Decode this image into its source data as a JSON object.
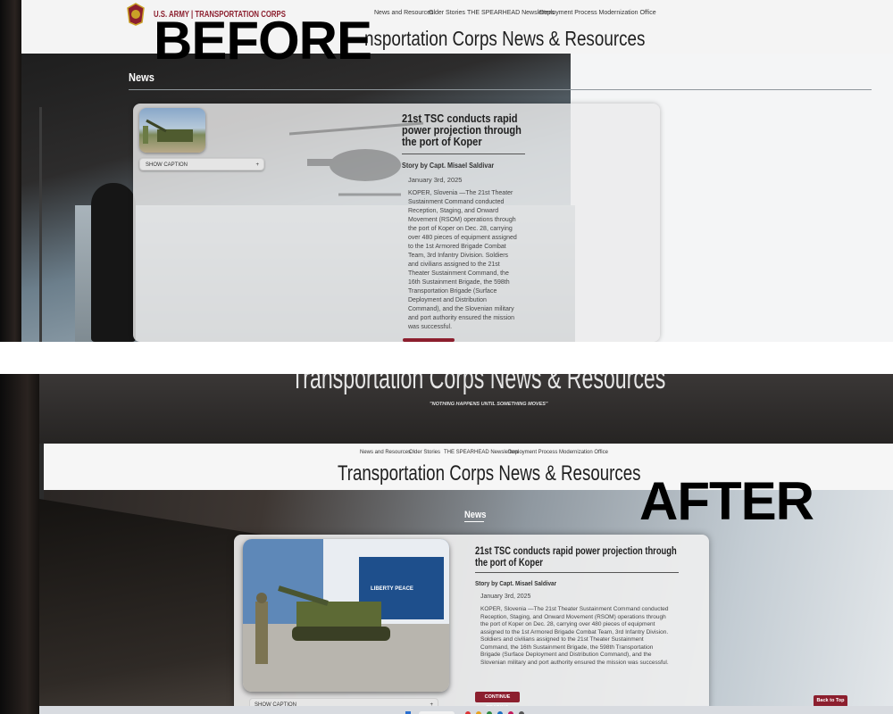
{
  "labels": {
    "before": "BEFORE",
    "after": "AFTER"
  },
  "site": {
    "brand": "U.S. ARMY | TRANSPORTATION CORPS",
    "nav": [
      "News and Resources",
      "Older Stories",
      "THE SPEARHEAD Newsletters",
      "Deployment Process Modernization Office"
    ],
    "page_title": "Transportation Corps News & Resources",
    "page_title_partial": "nsportation Corps News & Resources",
    "motto": "\"NOTHING HAPPENS UNTIL SOMETHING MOVES\"",
    "section": "News"
  },
  "article": {
    "title": "21st TSC conducts rapid power projection through the port of Koper",
    "byline": "Story by Capt. Misael Saldivar",
    "date": "January 3rd, 2025",
    "body": "KOPER, Slovenia —The 21st Theater Sustainment Command conducted Reception, Staging, and Onward Movement (RSOM) operations through the port of Koper on Dec. 28, carrying over 480 pieces of equipment assigned to the 1st Armored Brigade Combat Team, 3rd Infantry Division. Soldiers and civilians assigned to the 21st Theater Sustainment Command, the 16th Sustainment Brigade, the 598th Transportation Brigade (Surface Deployment and Distribution Command), and the Slovenian military and port authority ensured the mission was successful.",
    "caption_toggle": "SHOW CAPTION",
    "caption_plus": "+",
    "continue": "CONTINUE READING",
    "ship_name": "LIBERTY PEACE"
  },
  "back_to_top": "Back to Top",
  "colors": {
    "army_red": "#8c1f2e",
    "header_bg": "#f4f4f4"
  }
}
